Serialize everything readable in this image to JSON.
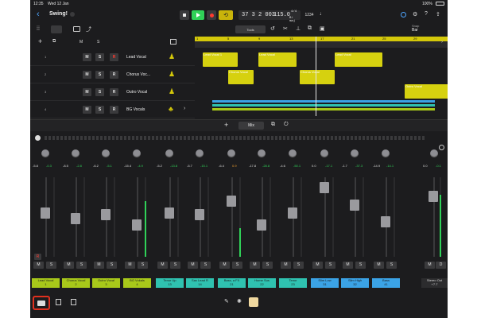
{
  "status": {
    "time": "12:35",
    "date": "Wed 12 Jan",
    "battery": "100%"
  },
  "project": {
    "title": "Swing!"
  },
  "transport": {
    "position": "37 3 2 003",
    "tempo": "115.0",
    "signature_top": "4/4",
    "key": "B♭ maj",
    "count_in": "1234"
  },
  "toolbar": {
    "snap_label": "Snap",
    "snap_value": "Bar",
    "tool_label": "Tools"
  },
  "ruler": {
    "bars": [
      "1",
      "5",
      "9",
      "13",
      "17",
      "21",
      "25",
      "29"
    ]
  },
  "tracks": [
    {
      "num": "1",
      "m": "M",
      "s": "S",
      "r": "R",
      "name": "Lead Vocal",
      "color": "#d4d10a"
    },
    {
      "num": "2",
      "m": "M",
      "s": "S",
      "r": "R",
      "name": "Chorus Voc...",
      "color": "#d4d10a"
    },
    {
      "num": "3",
      "m": "M",
      "s": "S",
      "r": "R",
      "name": "Outro Vocal",
      "color": "#d4d10a"
    },
    {
      "num": "4",
      "m": "M",
      "s": "S",
      "r": "R",
      "name": "BG Vocals",
      "color": "#d4d10a"
    }
  ],
  "regions": [
    {
      "label": "Lead Vocal 1",
      "color": "#d6d10f"
    },
    {
      "label": "Chorus Vocal",
      "color": "#d6d10f"
    },
    {
      "label": "Lead Vocal",
      "color": "#d6d10f"
    },
    {
      "label": "Chorus Vocal",
      "color": "#d6d10f"
    },
    {
      "label": "Lead Vocal",
      "color": "#d6d10f"
    },
    {
      "label": "Outro Vocal",
      "color": "#d6d10f"
    }
  ],
  "mixer_bar": {
    "mix_label": "Mix"
  },
  "channels": [
    {
      "gain": "-5.8",
      "peak": "-0.3",
      "m": "M",
      "s": "S",
      "name": "Lead Vocal",
      "num": "1",
      "color": "#a8c81a",
      "fader": 0.56,
      "meter": 0.0,
      "rec": true
    },
    {
      "gain": "-8.5",
      "peak": "-2.8",
      "m": "M",
      "s": "S",
      "name": "Chorus Vocal",
      "num": "2",
      "color": "#a8c81a",
      "fader": 0.48,
      "meter": 0.0,
      "rec": false
    },
    {
      "gain": "-6.2",
      "peak": "-5.1",
      "m": "M",
      "s": "S",
      "name": "Outro Vocal",
      "num": "3",
      "color": "#a8c81a",
      "fader": 0.53,
      "meter": 0.0,
      "rec": false
    },
    {
      "gain": "-15.4",
      "peak": "-4.9",
      "m": "M",
      "s": "S",
      "name": "BG Vokals",
      "num": "4",
      "color": "#a8c81a",
      "fader": 0.38,
      "meter": 0.7,
      "rec": false
    },
    {
      "gain": "-5.2",
      "peak": "-13.8",
      "m": "M",
      "s": "S",
      "name": "Tenor Up",
      "num": "13",
      "color": "#2fc2b0",
      "fader": 0.56,
      "meter": 0.0,
      "rec": false
    },
    {
      "gain": "-5.7",
      "peak": "-15.1",
      "m": "M",
      "s": "S",
      "name": "Sax Lead R",
      "num": "14",
      "color": "#2fc2b0",
      "fader": 0.53,
      "meter": 0.0,
      "rec": false
    },
    {
      "gain": "-6.4",
      "peak": "0.9",
      "m": "M",
      "s": "S",
      "name": "Bass, a FX",
      "num": "21",
      "color": "#2fc2b0",
      "fader": 0.73,
      "meter": 0.36,
      "rec": false
    },
    {
      "gain": "-17.8",
      "peak": "-28.8",
      "m": "M",
      "s": "S",
      "name": "Home Sus",
      "num": "22",
      "color": "#2fc2b0",
      "fader": 0.38,
      "meter": 0.0,
      "rec": false
    },
    {
      "gain": "-4.6",
      "peak": "-50.1",
      "m": "M",
      "s": "S",
      "name": "Tenor",
      "num": "23",
      "color": "#2fc2b0",
      "fader": 0.56,
      "meter": 0.0,
      "rec": false
    },
    {
      "gain": "0.0",
      "peak": "-17.1",
      "m": "M",
      "s": "S",
      "name": "Slim Low",
      "num": "31",
      "color": "#3ba3e6",
      "fader": 0.93,
      "meter": 0.0,
      "rec": false
    },
    {
      "gain": "-1.7",
      "peak": "-37.3",
      "m": "M",
      "s": "S",
      "name": "Slim High",
      "num": "32",
      "color": "#3ba3e6",
      "fader": 0.68,
      "meter": 0.0,
      "rec": false
    },
    {
      "gain": "-14.9",
      "peak": "-14.1",
      "m": "M",
      "s": "S",
      "name": "Bass",
      "num": "41",
      "color": "#3ba3e6",
      "fader": 0.43,
      "meter": 0.0,
      "rec": false
    }
  ],
  "stereo_out": {
    "gain": "0.0",
    "peak": "-0.1",
    "m": "M",
    "d": "D",
    "name": "Stereo Out",
    "value": "+7.7",
    "fader": 0.8,
    "meter": 0.78
  },
  "colors": {
    "accent_green": "#30d158",
    "accent_yellow": "#d4c80a",
    "record_red": "#ff3b30",
    "orange_peak": "#f0a030"
  }
}
